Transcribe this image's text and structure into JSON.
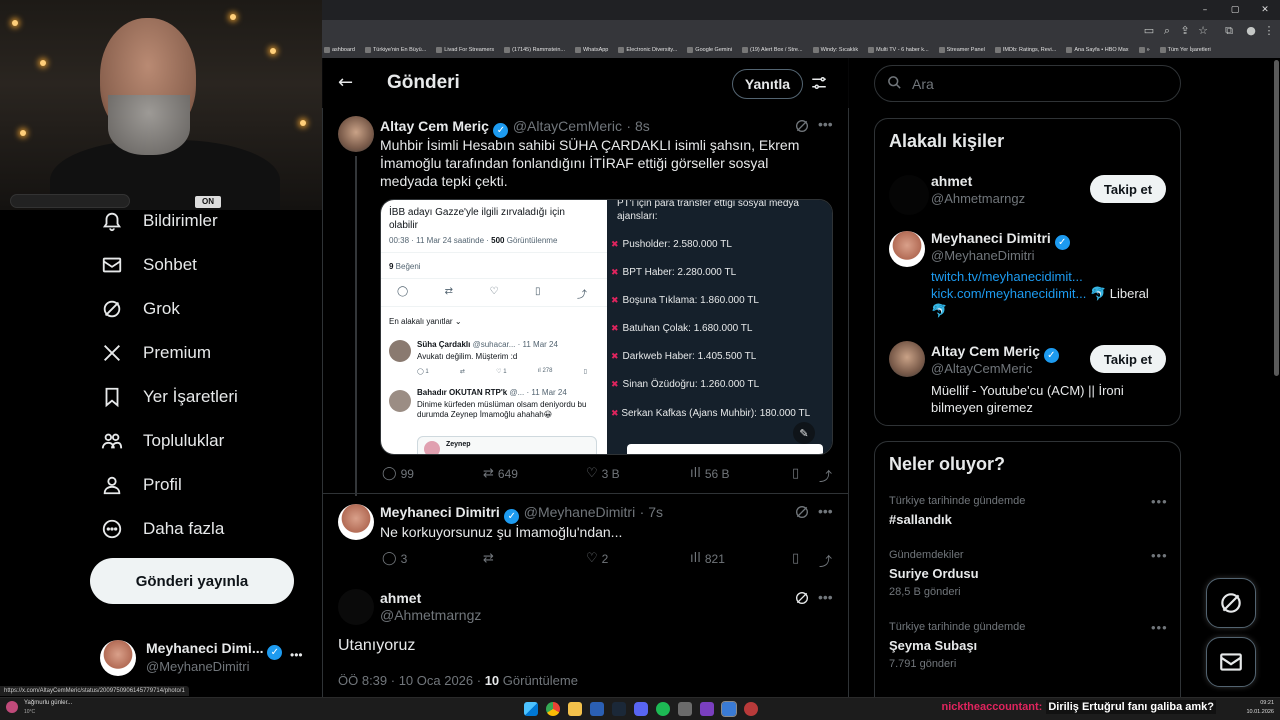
{
  "browser": {
    "bookmarks": [
      "ashboard",
      "Türkiye'nin En Büyü...",
      "Livad For Streamers",
      "(17145) Rammstein...",
      "WhatsApp",
      "Electronic Diversity...",
      "Google Gemini",
      "(19) Alert Box / Stre...",
      "Windy: Sıcaklık",
      "Multi TV - 6 haber k...",
      "Streamer Panel",
      "IMDb: Ratings, Revi...",
      "Ana Sayfa • HBO Max",
      "»",
      "Tüm Yer İşaretleri"
    ],
    "status_url": "https://x.com/AltayCemMeric/status/2009750906145779714/photo/1"
  },
  "webcam": {
    "sign_text": "ON"
  },
  "nav": {
    "items": [
      {
        "label": "Bildirimler",
        "icon": "bell-icon"
      },
      {
        "label": "Sohbet",
        "icon": "mail-icon"
      },
      {
        "label": "Grok",
        "icon": "grok-icon"
      },
      {
        "label": "Premium",
        "icon": "x-logo-icon"
      },
      {
        "label": "Yer İşaretleri",
        "icon": "bookmark-icon"
      },
      {
        "label": "Topluluklar",
        "icon": "communities-icon"
      },
      {
        "label": "Profil",
        "icon": "profile-icon"
      },
      {
        "label": "Daha fazla",
        "icon": "more-circle-icon"
      }
    ],
    "post_button": "Gönderi yayınla",
    "account": {
      "name": "Meyhaneci Dimi...",
      "handle": "@MeyhaneDimitri",
      "more": "•••"
    }
  },
  "main": {
    "header": {
      "title": "Gönderi",
      "reply_button": "Yanıtla"
    },
    "tweet1": {
      "name": "Altay Cem Meriç",
      "handle": "@AltayCemMeric",
      "time": "· 8s",
      "text": "Muhbir İsimli Hesabın sahibi SÜHA ÇARDAKLI isimli şahsın, Ekrem İmamoğlu tarafından fonlandığını İTİRAF ettiği görseller sosyal medyada tepki çekti.",
      "media_left": {
        "headline": "İBB adayı Gazze'yle ilgili zırvaladığı için olabilir",
        "meta_pre": "00:38 · 11 Mar 24 saatinde · ",
        "meta_views": "500",
        "meta_post": " Görüntülenme",
        "likes_num": "9",
        "likes_label": " Beğeni",
        "sort_label": "En alakalı yanıtlar",
        "reply1_name": "Süha Çardaklı",
        "reply1_handle": "@suhacar...",
        "reply1_date": "· 11 Mar 24",
        "reply1_text": "Avukatı değilim. Müşterim :d",
        "reply1_stats": [
          "1",
          "1",
          "278"
        ],
        "reply2_name": "Bahadır OKUTAN RTP'k",
        "reply2_handle": "@...",
        "reply2_date": "· 11 Mar 24",
        "reply2_text": "Dinime kürfeden müslüman olsam deniyordu bu durumda Zeynep İmamoğlu ahahah😀",
        "card_name": "Zeynep"
      },
      "media_right": {
        "header": "PT'i için para transfer ettiği sosyal medya ajansları:",
        "rows": [
          "Pusholder: 2.580.000 TL",
          "BPT Haber: 2.280.000 TL",
          "Boşuna Tıklama: 1.860.000 TL",
          "Batuhan Çolak: 1.680.000 TL",
          "Darkweb Haber: 1.405.500 TL",
          "Sinan Özüdoğru: 1.260.000 TL",
          "Serkan Kafkas (Ajans Muhbir): 180.000 TL"
        ]
      },
      "stats": {
        "replies": "99",
        "reposts": "649",
        "likes": "3 B",
        "views": "56 B"
      }
    },
    "tweet2": {
      "name": "Meyhaneci Dimitri",
      "handle": "@MeyhaneDimitri",
      "time": "· 7s",
      "text": "Ne korkuyorsunuz şu İmamoğlu'ndan...",
      "stats": {
        "replies": "3",
        "reposts": "",
        "likes": "2",
        "views": "821"
      }
    },
    "tweet3": {
      "name": "ahmet",
      "handle": "@Ahmetmarngz",
      "text": "Utanıyoruz",
      "meta_pre": "ÖÖ 8:39 · 10 Oca 2026 · ",
      "views": "10",
      "views_label": " Görüntüleme"
    }
  },
  "right": {
    "search_placeholder": "Ara",
    "related": {
      "title": "Alakalı kişiler",
      "people": [
        {
          "name": "ahmet",
          "handle": "@Ahmetmarngz",
          "button": "Takip et"
        },
        {
          "name": "Meyhaneci Dimitri",
          "handle": "@MeyhaneDimitri",
          "link1": "twitch.tv/meyhanecidimit...",
          "link2": "kick.com/meyhanecidimit...",
          "bio_tail": " 🐬 Liberal",
          "bio_end": "🐬"
        },
        {
          "name": "Altay Cem Meriç",
          "handle": "@AltayCemMeric",
          "button": "Takip et",
          "bio": "Müellif - Youtube'cu (ACM) || İroni bilmeyen giremez"
        }
      ]
    },
    "trends": {
      "title": "Neler oluyor?",
      "items": [
        {
          "meta": "Türkiye tarihinde gündemde",
          "name": "#sallandık",
          "count": ""
        },
        {
          "meta": "Gündemdekiler",
          "name": "Suriye Ordusu",
          "count": "28,5 B gönderi"
        },
        {
          "meta": "Türkiye tarihinde gündemde",
          "name": "Şeyma Subaşı",
          "count": "7.791 gönderi"
        }
      ],
      "more": "•••"
    }
  },
  "taskbar": {
    "weather_title": "Yağmurlu günler...",
    "weather_temp": "10°C",
    "chat_user": "nicktheaccountant:",
    "chat_message": "Diriliş Ertuğrul fanı galiba amk?",
    "time": "09:21",
    "date": "10.01.2026"
  },
  "colors": {
    "accent": "#1d9bf0",
    "background": "#000000",
    "text": "#e7e9ea",
    "muted": "#71767b",
    "chat_user": "#e0245e"
  }
}
